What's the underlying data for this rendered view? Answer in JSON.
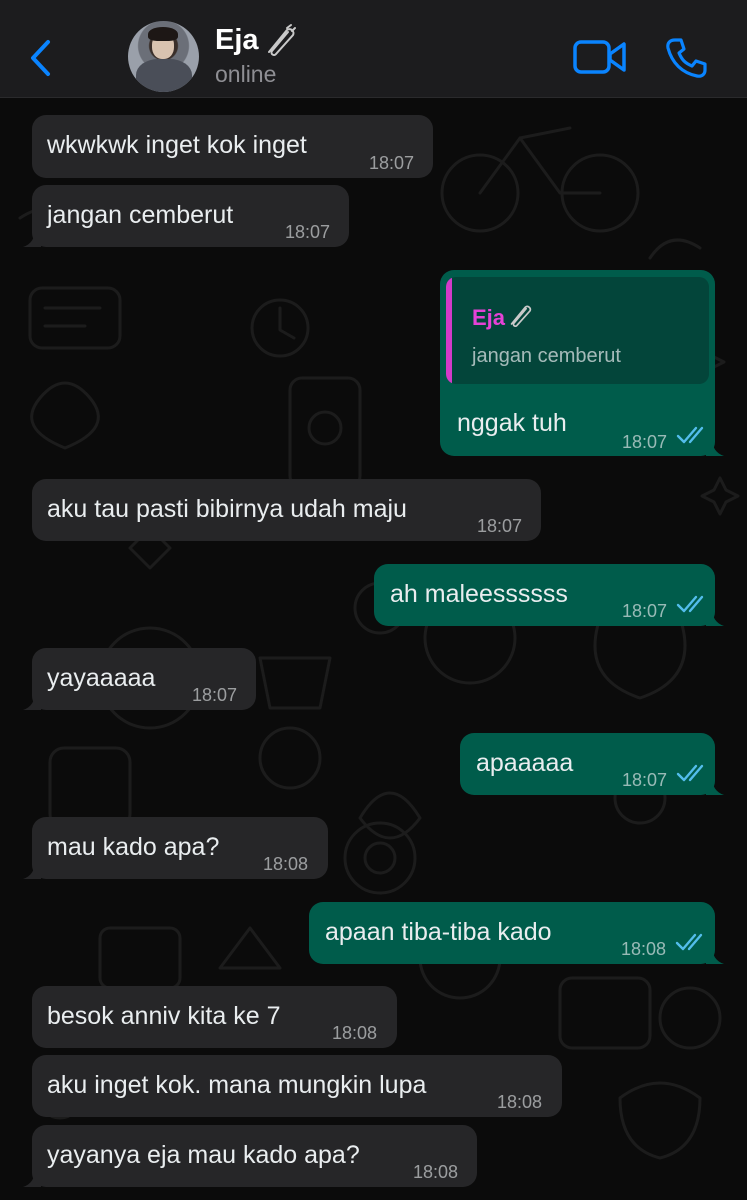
{
  "header": {
    "back_icon": "chevron-left-icon",
    "contact_name": "Eja",
    "name_icon": "paperclip-icon",
    "status": "online",
    "video_icon": "video-call-icon",
    "phone_icon": "phone-call-icon"
  },
  "colors": {
    "accent": "#0a84ff",
    "incoming_bubble": "#262628",
    "outgoing_bubble": "#005c4b",
    "quote_bar": "#d33ac9",
    "read_ticks": "#53bdeb"
  },
  "messages": [
    {
      "direction": "in",
      "text": "wkwkwk inget kok inget",
      "time": "18:07"
    },
    {
      "direction": "in",
      "text": "jangan cemberut",
      "time": "18:07"
    },
    {
      "direction": "out",
      "text": "nggak tuh",
      "time": "18:07",
      "status": "read",
      "reply_to": {
        "name": "Eja",
        "text": "jangan cemberut"
      }
    },
    {
      "direction": "in",
      "text": "aku tau pasti bibirnya udah maju",
      "time": "18:07"
    },
    {
      "direction": "out",
      "text": "ah maleessssss",
      "time": "18:07",
      "status": "read"
    },
    {
      "direction": "in",
      "text": "yayaaaaa",
      "time": "18:07"
    },
    {
      "direction": "out",
      "text": "apaaaaa",
      "time": "18:07",
      "status": "read"
    },
    {
      "direction": "in",
      "text": "mau kado apa?",
      "time": "18:08"
    },
    {
      "direction": "out",
      "text": "apaan tiba-tiba kado",
      "time": "18:08",
      "status": "read"
    },
    {
      "direction": "in",
      "text": "besok anniv kita ke 7",
      "time": "18:08"
    },
    {
      "direction": "in",
      "text": "aku inget kok. mana mungkin lupa",
      "time": "18:08"
    },
    {
      "direction": "in",
      "text": "yayanya eja mau kado apa?",
      "time": "18:08"
    }
  ]
}
